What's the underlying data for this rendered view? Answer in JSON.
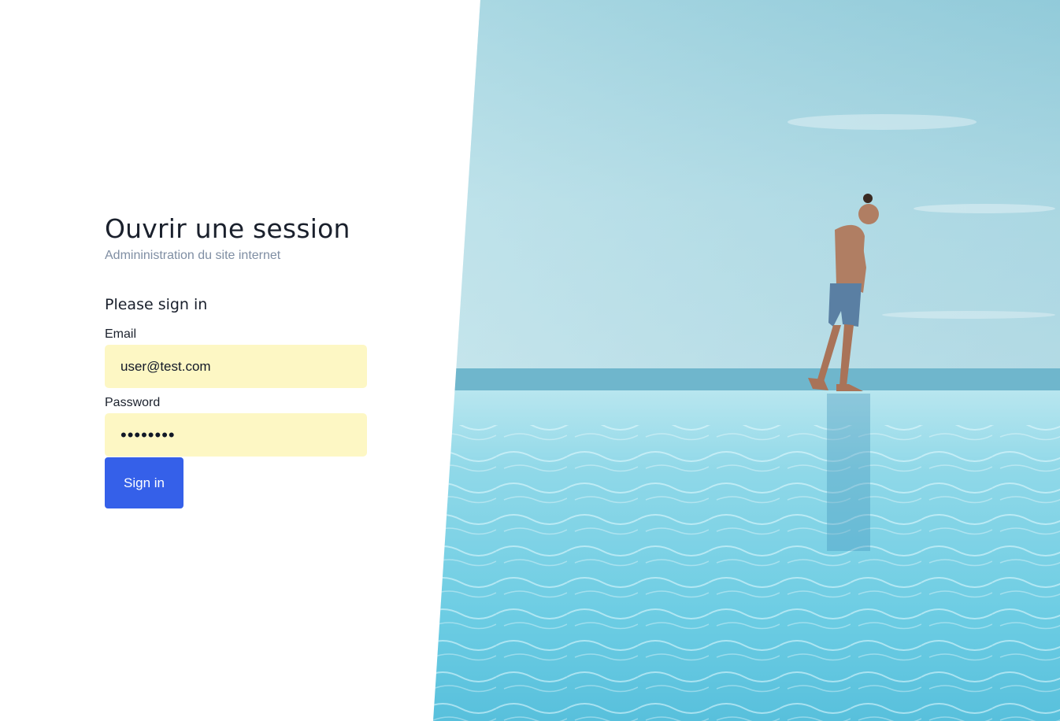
{
  "login": {
    "title": "Ouvrir une session",
    "subtitle": "Admininistration du site internet",
    "form_heading": "Please sign in",
    "email": {
      "label": "Email",
      "value": "user@test.com"
    },
    "password": {
      "label": "Password",
      "value": "password"
    },
    "submit_label": "Sign in"
  },
  "colors": {
    "primary_button": "#3560e9",
    "autofill_field": "#fdf7c4",
    "subtitle_text": "#7f8ea3"
  }
}
